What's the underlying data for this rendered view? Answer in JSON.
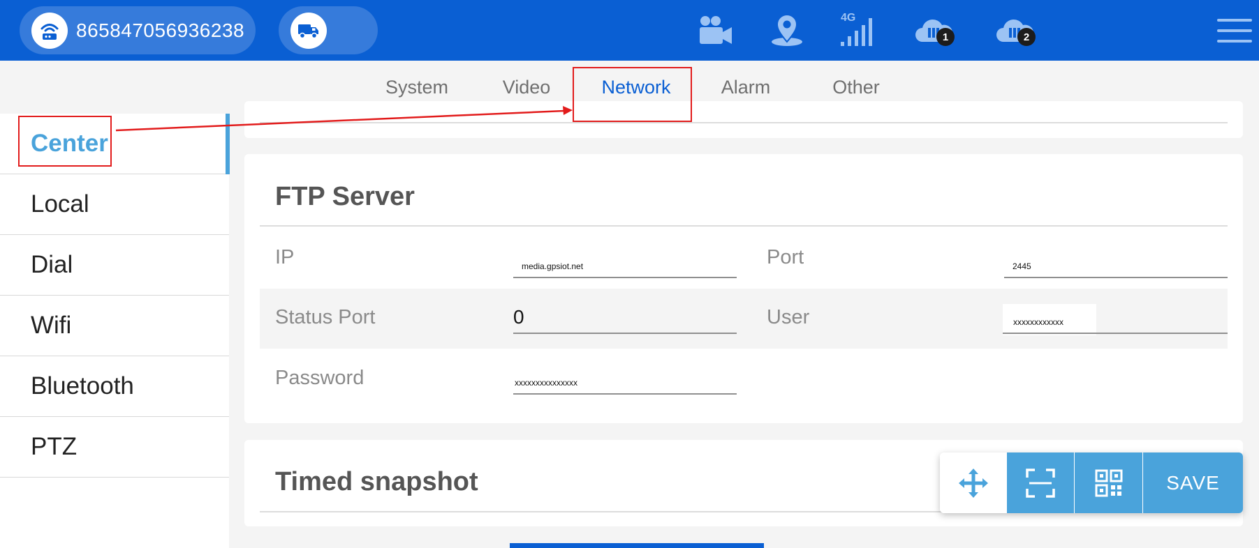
{
  "header": {
    "device_id": "865847056936238",
    "icons": [
      "router-icon",
      "truck-icon",
      "camera-icon",
      "location-icon",
      "signal-4g-icon",
      "cloud-server-1-icon",
      "cloud-server-2-icon",
      "menu-icon"
    ],
    "network_label": "4G",
    "server1_badge": "1",
    "server2_badge": "2"
  },
  "tabs": [
    {
      "label": "System"
    },
    {
      "label": "Video"
    },
    {
      "label": "Network",
      "active": true
    },
    {
      "label": "Alarm"
    },
    {
      "label": "Other"
    }
  ],
  "sidebar": {
    "items": [
      {
        "label": "Center",
        "active": true
      },
      {
        "label": "Local"
      },
      {
        "label": "Dial"
      },
      {
        "label": "Wifi"
      },
      {
        "label": "Bluetooth"
      },
      {
        "label": "PTZ"
      }
    ]
  },
  "ftp": {
    "title": "FTP Server",
    "ip_label": "IP",
    "ip_value": "media.gpsiot.net",
    "port_label": "Port",
    "port_value": "2445",
    "status_port_label": "Status Port",
    "status_port_value": "0",
    "user_label": "User",
    "user_value": "xxxxxxxxxxxx",
    "password_label": "Password",
    "password_value": "xxxxxxxxxxxxxxx"
  },
  "snapshot": {
    "title": "Timed snapshot"
  },
  "toolbar": {
    "save_label": "SAVE"
  },
  "colors": {
    "header_blue": "#0a5fd3",
    "accent": "#4aa3db",
    "annotation_red": "#e21b1b"
  }
}
